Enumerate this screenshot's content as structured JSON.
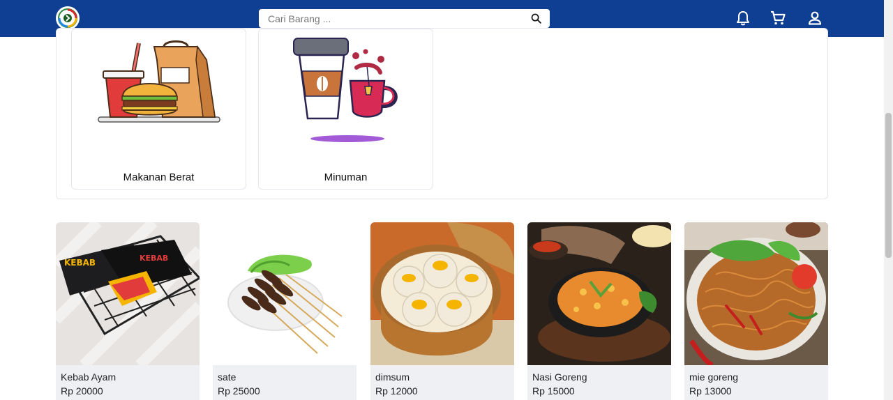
{
  "header": {
    "search_placeholder": "Cari Barang ...",
    "icons": [
      "search-icon",
      "bell-icon",
      "cart-icon",
      "user-icon"
    ],
    "colors": {
      "bar": "#0f3f92",
      "card_bg": "#eef0f4"
    }
  },
  "categories": [
    {
      "label": "Makanan Berat",
      "icon": "fast-food-illustration"
    },
    {
      "label": "Minuman",
      "icon": "coffee-tea-illustration"
    }
  ],
  "products": [
    {
      "name": "Kebab Ayam",
      "price": "Rp 20000"
    },
    {
      "name": "sate",
      "price": "Rp 25000"
    },
    {
      "name": "dimsum",
      "price": "Rp 12000"
    },
    {
      "name": "Nasi Goreng",
      "price": "Rp 15000"
    },
    {
      "name": "mie goreng",
      "price": "Rp 13000"
    }
  ]
}
